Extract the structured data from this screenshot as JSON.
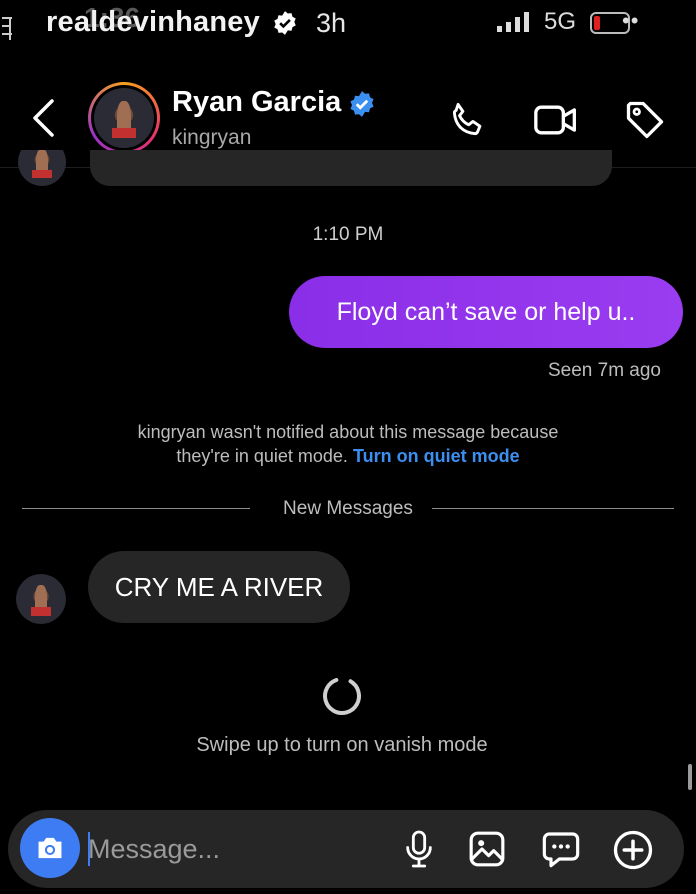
{
  "story": {
    "username": "realdevinhaney",
    "overlay_fragment": "1:36",
    "time": "3h"
  },
  "status_bar": {
    "network": "5G",
    "more": "••"
  },
  "header": {
    "name": "Ryan Garcia",
    "handle": "kingryan"
  },
  "messages": {
    "timestamp": "1:10 PM",
    "sent_text": "Floyd can’t save or help u..",
    "seen_text": "Seen 7m ago",
    "notice_line1": "kingryan wasn't notified about this message because",
    "notice_line2": "they're in quiet mode.",
    "notice_link": "Turn on quiet mode",
    "divider_label": "New Messages",
    "received_text": "CRY ME A RIVER",
    "vanish_hint": "Swipe up to turn on vanish mode"
  },
  "composer": {
    "placeholder": "Message..."
  },
  "colors": {
    "accent_purple": "#9a3cf0",
    "link_blue": "#3b8ff0",
    "camera_blue": "#3d7cf2",
    "bubble_gray": "#262626"
  },
  "icons": [
    "back-icon",
    "verified-badge-icon",
    "phone-icon",
    "video-icon",
    "tag-icon",
    "camera-icon",
    "microphone-icon",
    "gallery-icon",
    "sticker-chat-icon",
    "add-icon",
    "loading-spinner-icon"
  ]
}
